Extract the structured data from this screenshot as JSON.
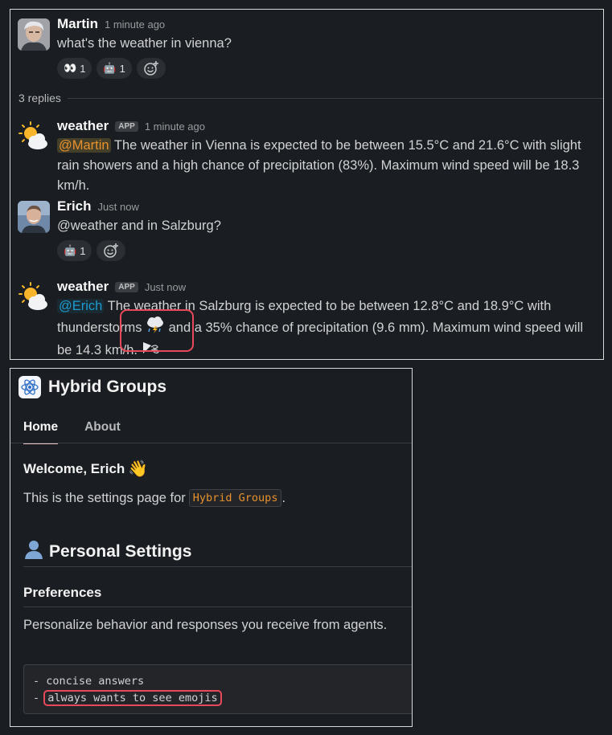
{
  "thread": {
    "messages": [
      {
        "author": "Martin",
        "time": "1 minute ago",
        "text": "what's the weather in vienna?",
        "reactions": [
          {
            "emoji": "👀",
            "count": "1"
          },
          {
            "emoji": "🤖",
            "count": "1"
          }
        ]
      },
      {
        "author": "weather",
        "badge": "APP",
        "time": "1 minute ago",
        "mention": "@Martin",
        "text": " The weather in Vienna is expected to be between 15.5°C and 21.6°C with slight rain showers and a high chance of precipitation (83%). Maximum wind speed will be 18.3 km/h."
      },
      {
        "author": "Erich",
        "time": "Just now",
        "text": "@weather and in Salzburg?",
        "reactions": [
          {
            "emoji": "🤖",
            "count": "1"
          }
        ]
      },
      {
        "author": "weather",
        "badge": "APP",
        "time": "Just now",
        "mention": "@Erich",
        "text_part1": " The weather in Salzburg is expected to be between 12.8°C and 18.9°C with thunderstorms ",
        "text_part2": " and a 35% chance of precipitation (9.6 mm). Maximum wind speed will be 14.3 km/h. ",
        "emoji_storm": "⛈",
        "emoji_wind": "🌬"
      }
    ],
    "replies_label": "3 replies"
  },
  "app_home": {
    "title": "Hybrid Groups",
    "tabs": [
      "Home",
      "About"
    ],
    "welcome": "Welcome, Erich",
    "welcome_emoji": "👋",
    "intro_text": "This is the settings page for",
    "intro_code": "Hybrid Groups",
    "intro_end": ".",
    "section_emoji": "👤",
    "section_title": "Personal Settings",
    "subsection_title": "Preferences",
    "description": "Personalize behavior and responses you receive from agents.",
    "code_line1": "- concise answers",
    "code_line2_prefix": "- ",
    "code_line2_highlight": "always wants to see emojis"
  },
  "colors": {
    "background": "#1a1d21",
    "mention_yellow": "#e8912d",
    "mention_blue": "#1d9bd1",
    "highlight": "#e8495a"
  }
}
